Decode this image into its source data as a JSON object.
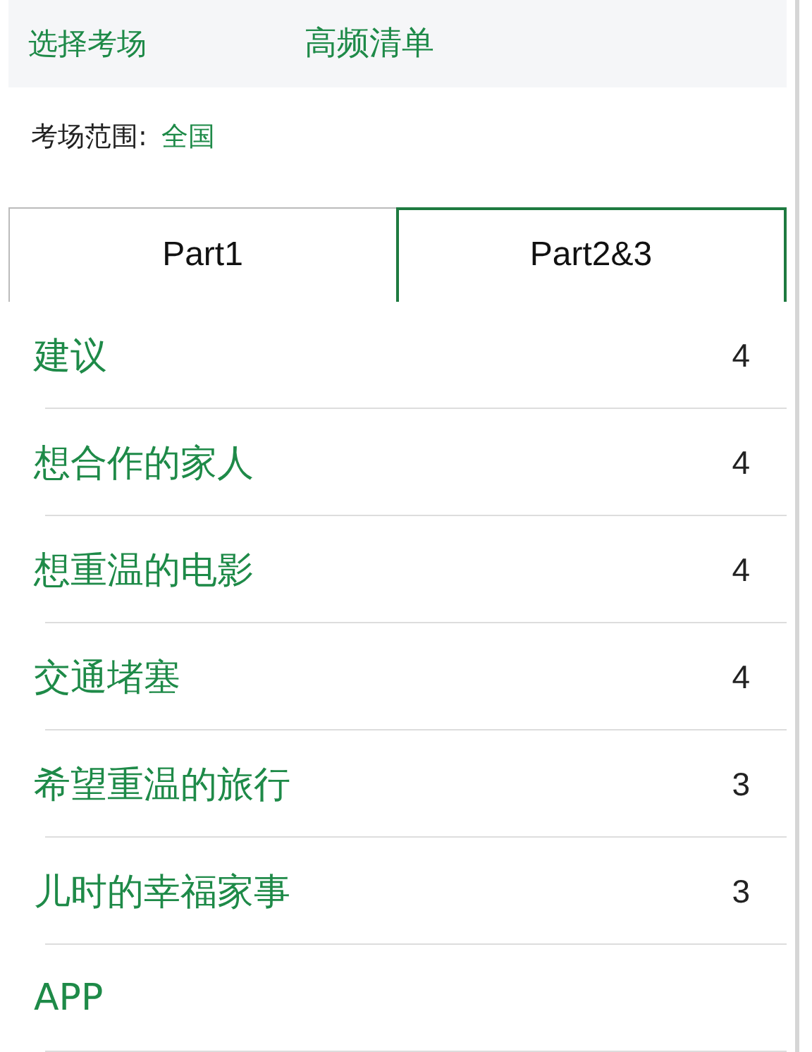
{
  "header": {
    "back": "选择考场",
    "title": "高频清单"
  },
  "scope": {
    "label": "考场范围:",
    "value": "全国"
  },
  "tabs": [
    {
      "label": "Part1",
      "selected": false
    },
    {
      "label": "Part2&3",
      "selected": true
    }
  ],
  "topics": [
    {
      "title": "建议",
      "count": "4"
    },
    {
      "title": "想合作的家人",
      "count": "4"
    },
    {
      "title": "想重温的电影",
      "count": "4"
    },
    {
      "title": "交通堵塞",
      "count": "4"
    },
    {
      "title": "希望重温的旅行",
      "count": "3"
    },
    {
      "title": "儿时的幸福家事",
      "count": "3"
    },
    {
      "title": "APP"
    }
  ]
}
